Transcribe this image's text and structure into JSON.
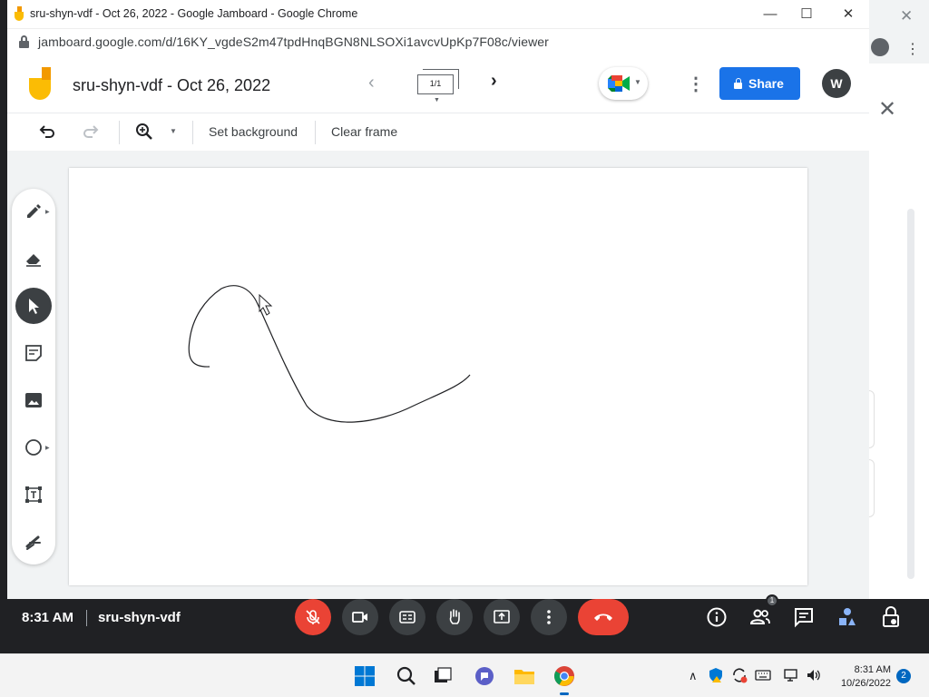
{
  "browser": {
    "tab_title": "sru-shyn-vdf - Oct 26, 2022 - Google Jamboard - Google Chrome",
    "url": "jamboard.google.com/d/16KY_vgdeS2m47tpdHnqBGN8NLSOXi1avcvUpKp7F08c/viewer",
    "window_controls": {
      "minimize": "—",
      "maximize": "☐",
      "close": "✕"
    }
  },
  "jamboard": {
    "doc_title": "sru-shyn-vdf - Oct 26, 2022",
    "frame_indicator": "1/1",
    "share_label": "Share",
    "avatar_initial": "W",
    "toolbar": {
      "set_background": "Set background",
      "clear_frame": "Clear frame"
    },
    "tools": [
      "pen",
      "eraser",
      "select",
      "sticky-note",
      "image",
      "shape",
      "text-box",
      "laser"
    ],
    "selected_tool": "select"
  },
  "meet": {
    "time": "8:31 AM",
    "meeting_name": "sru-shyn-vdf",
    "people_badge": "1",
    "colors": {
      "end_call": "#ea4335",
      "mic_off": "#ea4335",
      "bar": "#202124"
    }
  },
  "taskbar": {
    "time": "8:31 AM",
    "date": "10/26/2022",
    "notification_count": "2"
  }
}
